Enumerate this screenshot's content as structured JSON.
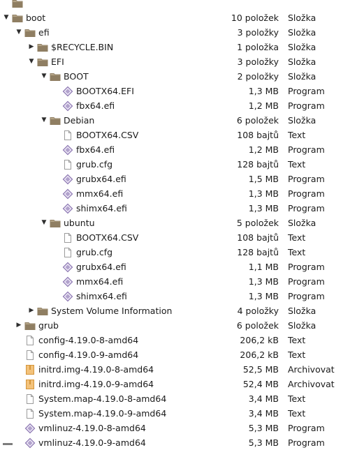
{
  "tree": [
    {
      "name": "",
      "size": "",
      "type": "",
      "icon": "folder-icon",
      "depth": 0,
      "expander": "none"
    },
    {
      "name": "boot",
      "size": "10 položek",
      "type": "Složka",
      "icon": "folder-icon",
      "depth": 0,
      "expander": "expanded"
    },
    {
      "name": "efi",
      "size": "3 položky",
      "type": "Složka",
      "icon": "folder-icon",
      "depth": 1,
      "expander": "expanded"
    },
    {
      "name": "$RECYCLE.BIN",
      "size": "1 položka",
      "type": "Složka",
      "icon": "folder-icon",
      "depth": 2,
      "expander": "collapsed"
    },
    {
      "name": "EFI",
      "size": "3 položky",
      "type": "Složka",
      "icon": "folder-icon",
      "depth": 2,
      "expander": "expanded"
    },
    {
      "name": "BOOT",
      "size": "2 položky",
      "type": "Složka",
      "icon": "folder-icon",
      "depth": 3,
      "expander": "expanded"
    },
    {
      "name": "BOOTX64.EFI",
      "size": "1,3 MB",
      "type": "Program",
      "icon": "executable-icon",
      "depth": 4,
      "expander": "none"
    },
    {
      "name": "fbx64.efi",
      "size": "1,2 MB",
      "type": "Program",
      "icon": "executable-icon",
      "depth": 4,
      "expander": "none"
    },
    {
      "name": "Debian",
      "size": "6 položek",
      "type": "Složka",
      "icon": "folder-icon",
      "depth": 3,
      "expander": "expanded"
    },
    {
      "name": "BOOTX64.CSV",
      "size": "108 bajtů",
      "type": "Text",
      "icon": "text-file-icon",
      "depth": 4,
      "expander": "none"
    },
    {
      "name": "fbx64.efi",
      "size": "1,2 MB",
      "type": "Program",
      "icon": "executable-icon",
      "depth": 4,
      "expander": "none"
    },
    {
      "name": "grub.cfg",
      "size": "128 bajtů",
      "type": "Text",
      "icon": "text-file-icon",
      "depth": 4,
      "expander": "none"
    },
    {
      "name": "grubx64.efi",
      "size": "1,5 MB",
      "type": "Program",
      "icon": "executable-icon",
      "depth": 4,
      "expander": "none"
    },
    {
      "name": "mmx64.efi",
      "size": "1,3 MB",
      "type": "Program",
      "icon": "executable-icon",
      "depth": 4,
      "expander": "none"
    },
    {
      "name": "shimx64.efi",
      "size": "1,3 MB",
      "type": "Program",
      "icon": "executable-icon",
      "depth": 4,
      "expander": "none"
    },
    {
      "name": "ubuntu",
      "size": "5 položek",
      "type": "Složka",
      "icon": "folder-icon",
      "depth": 3,
      "expander": "expanded"
    },
    {
      "name": "BOOTX64.CSV",
      "size": "108 bajtů",
      "type": "Text",
      "icon": "text-file-icon",
      "depth": 4,
      "expander": "none"
    },
    {
      "name": "grub.cfg",
      "size": "128 bajtů",
      "type": "Text",
      "icon": "text-file-icon",
      "depth": 4,
      "expander": "none"
    },
    {
      "name": "grubx64.efi",
      "size": "1,1 MB",
      "type": "Program",
      "icon": "executable-icon",
      "depth": 4,
      "expander": "none"
    },
    {
      "name": "mmx64.efi",
      "size": "1,3 MB",
      "type": "Program",
      "icon": "executable-icon",
      "depth": 4,
      "expander": "none"
    },
    {
      "name": "shimx64.efi",
      "size": "1,3 MB",
      "type": "Program",
      "icon": "executable-icon",
      "depth": 4,
      "expander": "none"
    },
    {
      "name": "System Volume Information",
      "size": "4 položky",
      "type": "Složka",
      "icon": "folder-icon",
      "depth": 2,
      "expander": "collapsed"
    },
    {
      "name": "grub",
      "size": "6 položek",
      "type": "Složka",
      "icon": "folder-icon",
      "depth": 1,
      "expander": "collapsed"
    },
    {
      "name": "config-4.19.0-8-amd64",
      "size": "206,2 kB",
      "type": "Text",
      "icon": "text-file-icon",
      "depth": 1,
      "expander": "none"
    },
    {
      "name": "config-4.19.0-9-amd64",
      "size": "206,2 kB",
      "type": "Text",
      "icon": "text-file-icon",
      "depth": 1,
      "expander": "none"
    },
    {
      "name": "initrd.img-4.19.0-8-amd64",
      "size": "52,5 MB",
      "type": "Archivovat",
      "icon": "archive-icon",
      "depth": 1,
      "expander": "none"
    },
    {
      "name": "initrd.img-4.19.0-9-amd64",
      "size": "52,4 MB",
      "type": "Archivovat",
      "icon": "archive-icon",
      "depth": 1,
      "expander": "none"
    },
    {
      "name": "System.map-4.19.0-8-amd64",
      "size": "3,4 MB",
      "type": "Text",
      "icon": "text-file-icon",
      "depth": 1,
      "expander": "none"
    },
    {
      "name": "System.map-4.19.0-9-amd64",
      "size": "3,4 MB",
      "type": "Text",
      "icon": "text-file-icon",
      "depth": 1,
      "expander": "none"
    },
    {
      "name": "vmlinuz-4.19.0-8-amd64",
      "size": "5,3 MB",
      "type": "Program",
      "icon": "executable-icon",
      "depth": 1,
      "expander": "none"
    },
    {
      "name": "vmlinuz-4.19.0-9-amd64",
      "size": "5,3 MB",
      "type": "Program",
      "icon": "executable-icon",
      "depth": 1,
      "expander": "none"
    }
  ],
  "colors": {
    "folder": "#8f7e62",
    "folder_light": "#b5a588",
    "executable": "#8a74b0",
    "archive": "#d4953a",
    "text_file": "#9b9b9b"
  }
}
